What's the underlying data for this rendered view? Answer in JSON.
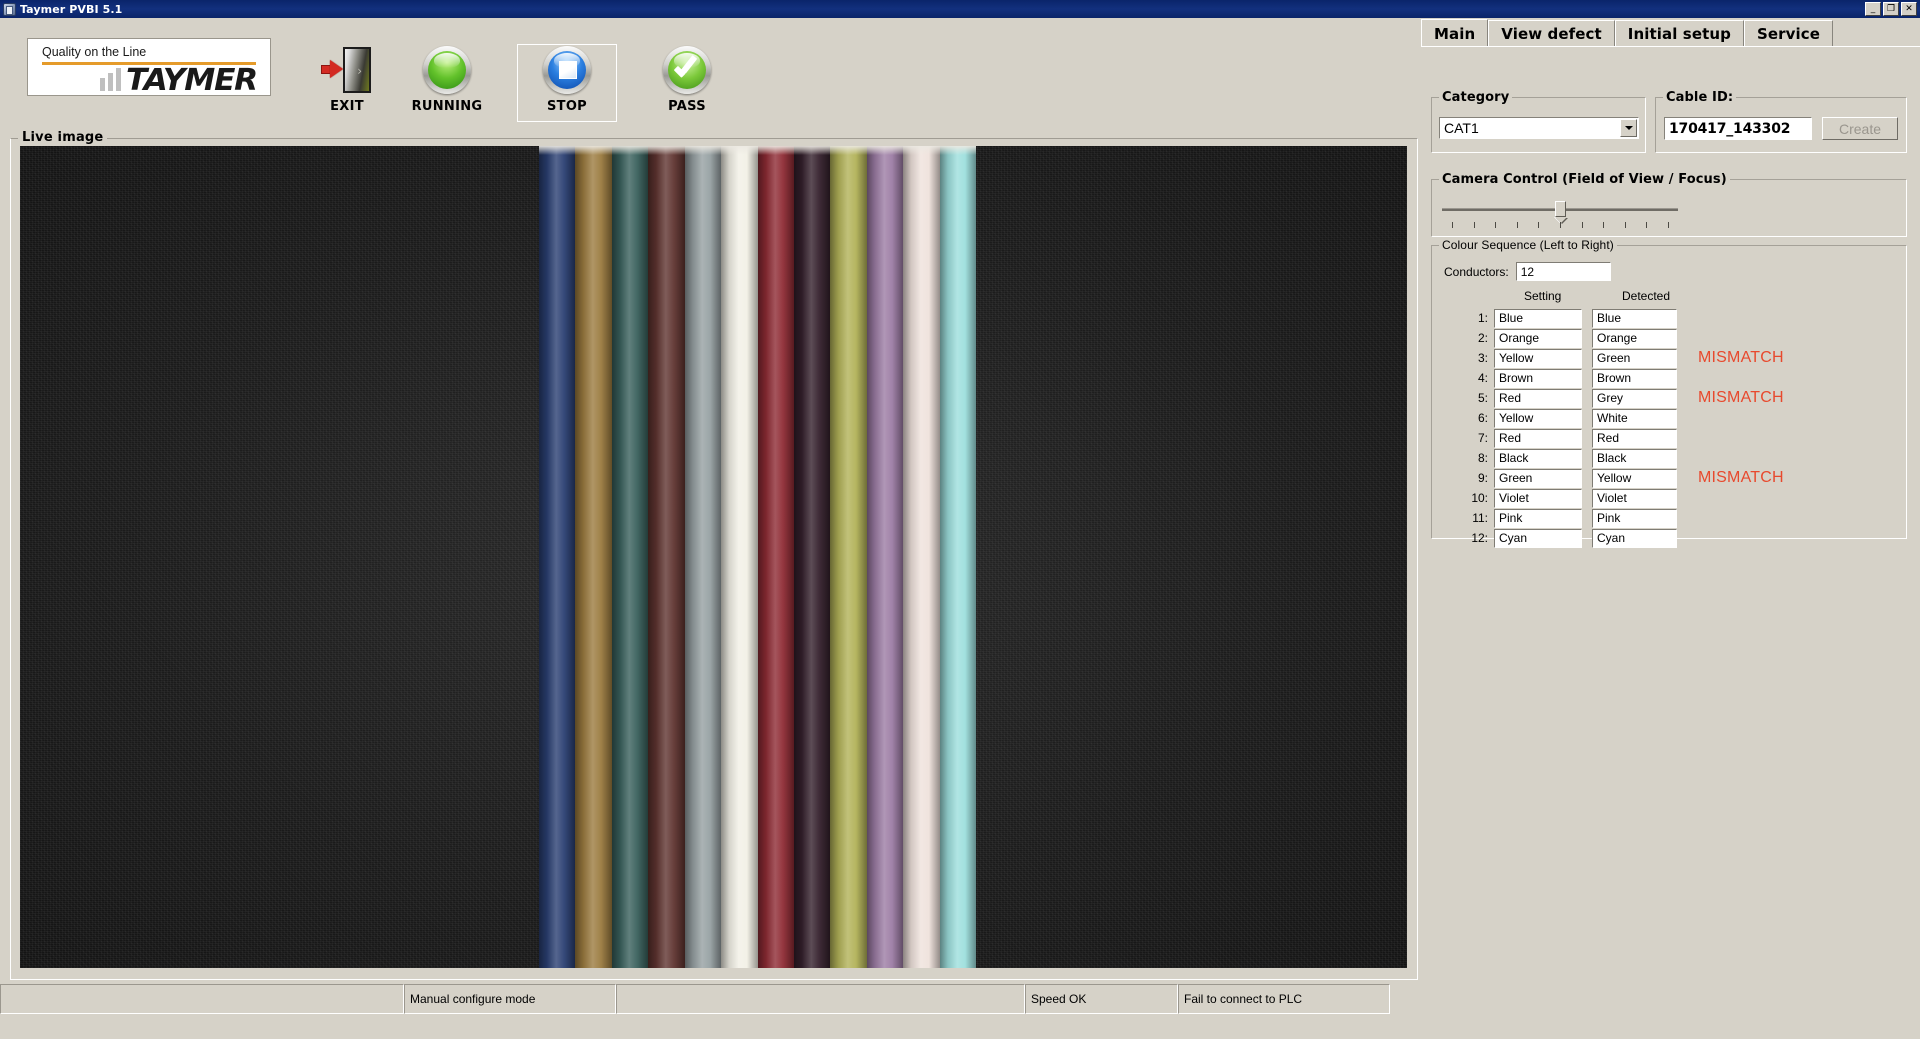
{
  "window": {
    "title": "Taymer PVBI 5.1",
    "controls": [
      {
        "name": "minimize",
        "glyph": "_"
      },
      {
        "name": "restore",
        "glyph": "❐"
      },
      {
        "name": "close",
        "glyph": "✕"
      }
    ]
  },
  "logo": {
    "tagline": "Quality on the Line",
    "wordmark": "TAYMER"
  },
  "toolbar": {
    "buttons": [
      {
        "label": "EXIT",
        "icon": "exit-door-icon",
        "focused": false
      },
      {
        "label": "RUNNING",
        "icon": "green-lamp-icon",
        "focused": false
      },
      {
        "label": "STOP",
        "icon": "blue-stop-icon",
        "focused": true
      },
      {
        "label": "PASS",
        "icon": "green-check-icon",
        "focused": false
      }
    ]
  },
  "live_image": {
    "legend": "Live image",
    "strip_colors": [
      "#2a3f72",
      "#9b7b3f",
      "#39605c",
      "#5f3430",
      "#96a0a2",
      "#f2f0e6",
      "#8e2b34",
      "#34202c",
      "#b2b258",
      "#9c7ca4",
      "#efe2dc",
      "#9ddfdd"
    ]
  },
  "statusbar": {
    "cells": [
      "",
      "Manual configure mode",
      "",
      "Speed OK",
      "Fail to connect to PLC"
    ]
  },
  "tabs": [
    {
      "label": "Main",
      "active": true
    },
    {
      "label": "View defect",
      "active": false
    },
    {
      "label": "Initial setup",
      "active": false
    },
    {
      "label": "Service",
      "active": false
    }
  ],
  "category": {
    "legend": "Category",
    "value": "CAT1",
    "options": [
      "CAT1"
    ]
  },
  "cable_id": {
    "legend": "Cable ID:",
    "value": "170417_143302",
    "create_label": "Create",
    "create_enabled": false
  },
  "camera_control": {
    "legend": "Camera Control (Field of View / Focus)",
    "slider_percent": 52,
    "tick_count": 11
  },
  "colour_sequence": {
    "legend": "Colour Sequence (Left to Right)",
    "conductors_label": "Conductors:",
    "conductors_value": "12",
    "header_setting": "Setting",
    "header_detected": "Detected",
    "mismatch_label": "MISMATCH",
    "mismatch_color": "#e8492d",
    "rows": [
      {
        "index": "1:",
        "setting": "Blue",
        "detected": "Blue",
        "mismatch": false
      },
      {
        "index": "2:",
        "setting": "Orange",
        "detected": "Orange",
        "mismatch": false
      },
      {
        "index": "3:",
        "setting": "Yellow",
        "detected": "Green",
        "mismatch": true
      },
      {
        "index": "4:",
        "setting": "Brown",
        "detected": "Brown",
        "mismatch": false
      },
      {
        "index": "5:",
        "setting": "Red",
        "detected": "Grey",
        "mismatch": true
      },
      {
        "index": "6:",
        "setting": "Yellow",
        "detected": "White",
        "mismatch": false
      },
      {
        "index": "7:",
        "setting": "Red",
        "detected": "Red",
        "mismatch": false
      },
      {
        "index": "8:",
        "setting": "Black",
        "detected": "Black",
        "mismatch": false
      },
      {
        "index": "9:",
        "setting": "Green",
        "detected": "Yellow",
        "mismatch": true
      },
      {
        "index": "10:",
        "setting": "Violet",
        "detected": "Violet",
        "mismatch": false
      },
      {
        "index": "11:",
        "setting": "Pink",
        "detected": "Pink",
        "mismatch": false
      },
      {
        "index": "12:",
        "setting": "Cyan",
        "detected": "Cyan",
        "mismatch": false
      }
    ]
  }
}
